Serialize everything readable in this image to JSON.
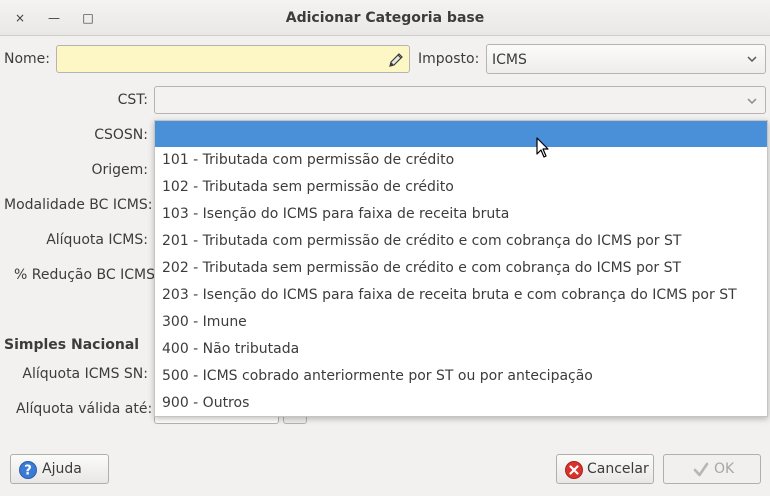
{
  "window": {
    "title": "Adicionar Categoria base",
    "close_label": "×",
    "minimize_label": "—",
    "maximize_label": "□"
  },
  "form": {
    "nome_label": "Nome:",
    "nome_value": "",
    "imposto_label": "Imposto:",
    "imposto_value": "ICMS",
    "cst_label": "CST:",
    "cst_value": "",
    "csosn_label": "CSOSN:",
    "origem_label": "Origem:",
    "modalidade_label": "Modalidade BC ICMS:",
    "aliquota_label": "Alíquota ICMS:",
    "reducao_label": "% Redução BC ICMS",
    "simples_section": "Simples Nacional",
    "aliquota_sn_label": "Alíquota ICMS SN:",
    "aliquota_valida_label": "Alíquota válida até:"
  },
  "csosn_dropdown": {
    "selected_index": 0,
    "options": [
      "",
      "101 - Tributada com permissão de crédito",
      "102 - Tributada sem permissão de crédito",
      "103 - Isenção do ICMS para faixa de receita bruta",
      "201 - Tributada com permissão de crédito e com cobrança do ICMS por ST",
      "202 - Tributada sem permissão de crédito e com cobrança do ICMS por ST",
      "203 - Isenção do ICMS para faixa de receita bruta e com cobrança do ICMS por ST",
      "300 - Imune",
      "400 - Não tributada",
      "500 - ICMS cobrado anteriormente por ST ou por antecipação",
      "900 - Outros"
    ]
  },
  "buttons": {
    "ajuda": "Ajuda",
    "cancelar": "Cancelar",
    "ok": "OK"
  },
  "colors": {
    "highlight": "#4a90d9",
    "required_field": "#fcf7c5",
    "cancel_icon": "#d9322b",
    "help_icon": "#3a7bd5"
  }
}
